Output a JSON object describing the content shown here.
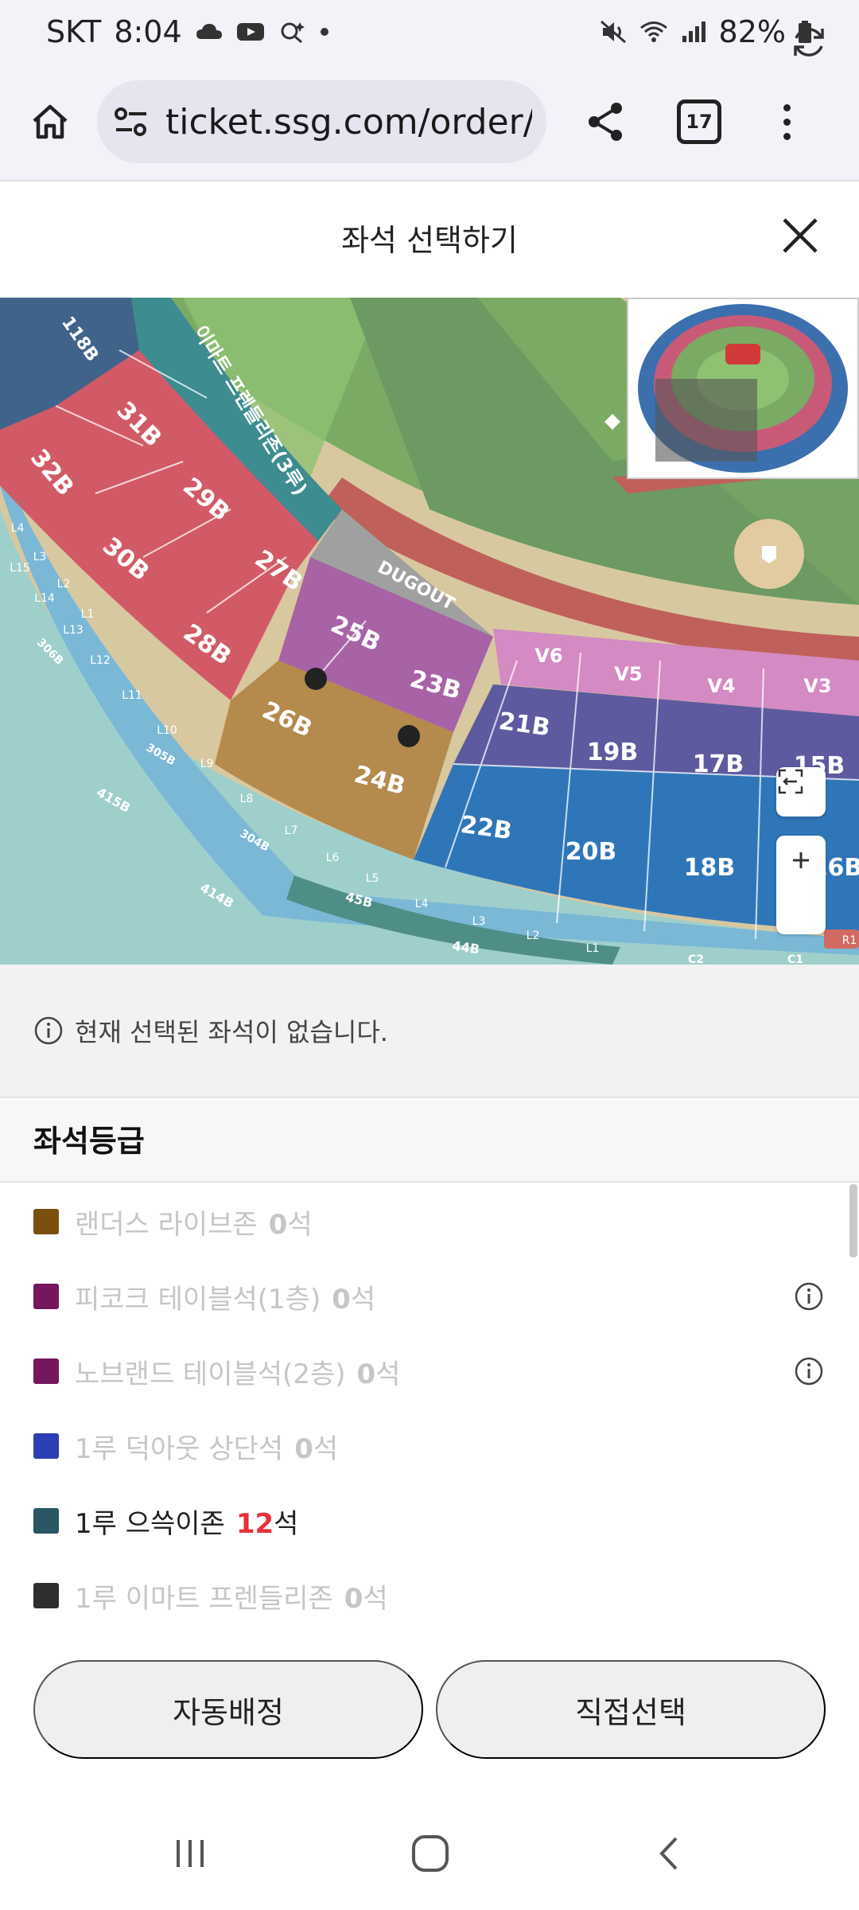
{
  "status_bar": {
    "carrier": "SKT",
    "time": "8:04",
    "battery": "82%"
  },
  "browser": {
    "url": "ticket.ssg.com/order/r",
    "tab_count": "17"
  },
  "modal": {
    "title": "좌석 선택하기"
  },
  "seat_map": {
    "sections": [
      "118B",
      "31B",
      "32B",
      "29B",
      "30B",
      "27B",
      "28B",
      "25B",
      "26B",
      "23B",
      "24B",
      "21B",
      "22B",
      "19B",
      "20B",
      "17B",
      "18B",
      "15B",
      "16B",
      "V6",
      "V5",
      "V4",
      "V3",
      "DUGOUT",
      "이마트 프렌들리존(3루)",
      "L4",
      "L3",
      "L2",
      "L1",
      "L5",
      "L6",
      "L7",
      "L8",
      "L9",
      "L10",
      "L11",
      "L12",
      "L13",
      "L14",
      "L15",
      "306B",
      "305B",
      "304B",
      "415B",
      "414B",
      "45B",
      "44B",
      "C2",
      "C1",
      "R1"
    ]
  },
  "notice": {
    "text": "현재 선택된 좌석이 없습니다."
  },
  "grades": {
    "title": "좌석등급",
    "items": [
      {
        "name": "랜더스 라이브존",
        "count": "0",
        "unit": "석",
        "color": "#7a4f0f",
        "info": false,
        "active": false
      },
      {
        "name": "피코크 테이블석(1층)",
        "count": "0",
        "unit": "석",
        "color": "#75175e",
        "info": true,
        "active": false
      },
      {
        "name": "노브랜드 테이블석(2층)",
        "count": "0",
        "unit": "석",
        "color": "#75175e",
        "info": true,
        "active": false
      },
      {
        "name": "1루 덕아웃 상단석",
        "count": "0",
        "unit": "석",
        "color": "#2b3fb5",
        "info": false,
        "active": false
      },
      {
        "name": "1루 으쓱이존",
        "count": "12",
        "unit": "석",
        "color": "#285662",
        "info": false,
        "active": true
      },
      {
        "name": "1루 이마트 프렌들리존",
        "count": "0",
        "unit": "석",
        "color": "#2e2e2e",
        "info": false,
        "active": false
      }
    ]
  },
  "actions": {
    "auto_assign": "자동배정",
    "manual_select": "직접선택"
  }
}
